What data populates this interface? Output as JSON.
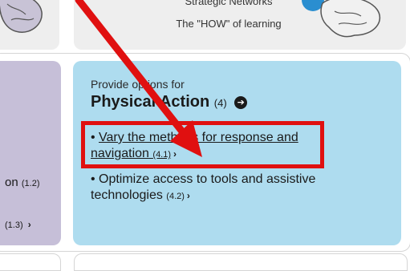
{
  "header": {
    "strategic_title": "Strategic Networks",
    "strategic_subtitle": "The \"HOW\" of learning"
  },
  "left_card": {
    "line1_text": "on",
    "line1_num": "(1.2)",
    "line2_text": "(1.3)",
    "line2_chevron": "›"
  },
  "main_card": {
    "provide_label": "Provide options for",
    "heading": "Physical Action",
    "heading_count": "(4)",
    "heading_icon": "➔",
    "items": [
      {
        "text": "Vary the methods for response and navigation",
        "num": "(4.1)",
        "chevron": "›"
      },
      {
        "text": "Optimize access to tools and assistive technologies",
        "num": "(4.2)",
        "chevron": "›"
      }
    ]
  },
  "annotation": {
    "arrow_color": "#e01010",
    "box_color": "#e01010"
  },
  "colors": {
    "blue_card": "#aedcef",
    "purple_card": "#c6bfd8",
    "header_card": "#eeeeee"
  }
}
